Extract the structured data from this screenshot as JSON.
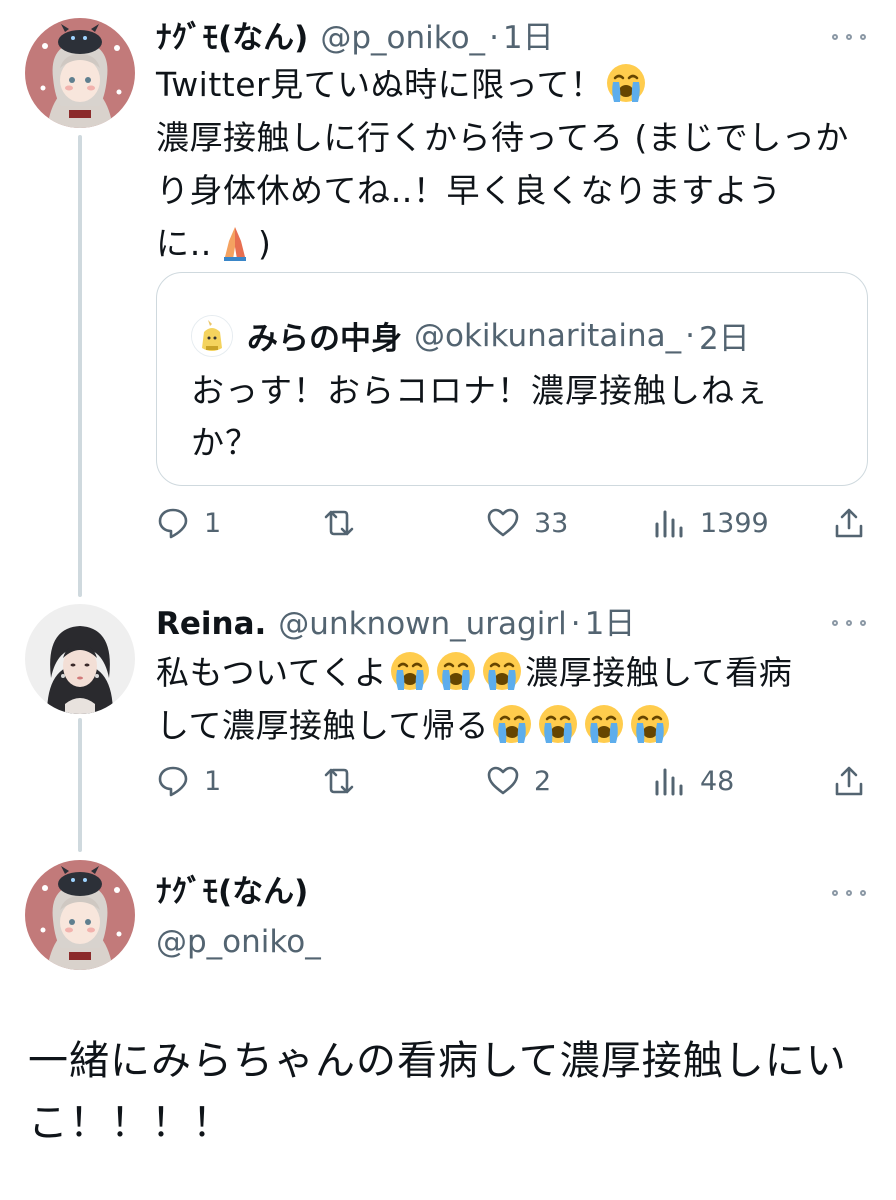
{
  "tweets": [
    {
      "display_name": "ﾅｸﾞﾓ(なん)",
      "handle": "@p_oniko_",
      "time": "1日",
      "text_line1": "Twitter見ていぬ時に限って！",
      "text_line2": "濃厚接触しに行くから待ってろ (まじでしっか",
      "text_line3": "り身体休めてね‥！早く良くなりますよう",
      "text_line4_a": "に‥",
      "text_line4_b": ")",
      "emoji_line1": "loudly-crying-face",
      "emoji_line4": "folded-hands",
      "quote": {
        "display_name": "みらの中身",
        "handle": "@okikunaritaina_",
        "time": "2日",
        "text": "おっす！おらコロナ！濃厚接触しねぇか？"
      },
      "stats": {
        "replies": "1",
        "likes": "33",
        "views": "1399"
      }
    },
    {
      "display_name": "Reina.",
      "handle": "@unknown_uragirl",
      "time": "1日",
      "text_line1_a": "私もついてくよ",
      "text_line1_b": "濃厚接触して看病",
      "text_line2": "して濃厚接触して帰る",
      "emoji": "loudly-crying-face",
      "stats": {
        "replies": "1",
        "likes": "2",
        "views": "48"
      }
    }
  ],
  "main_tweet": {
    "display_name": "ﾅｸﾞﾓ(なん)",
    "handle": "@p_oniko_",
    "text": "一緒にみらちゃんの看病して濃厚接触しにいこ！！！！"
  },
  "icons": {
    "reply": "speech-bubble-icon",
    "retweet": "retweet-arrows-icon",
    "like": "heart-icon",
    "views": "bar-chart-icon",
    "share": "share-upload-icon",
    "more": "three-dots-icon"
  },
  "colors": {
    "text": "#0f1419",
    "secondary": "#536471",
    "border": "#cfd9de",
    "avatar_bg": "#c27a7a"
  }
}
